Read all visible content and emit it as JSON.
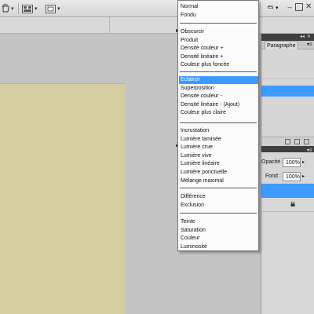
{
  "toolbar": {
    "items": [
      {
        "icon": "hand-tool-icon"
      },
      {
        "icon": "arrange-documents-icon"
      },
      {
        "icon": "screen-mode-icon"
      }
    ],
    "workspace_label": "es",
    "window_controls": {
      "minimize": "–",
      "maximize": "",
      "close": "✕"
    }
  },
  "panel_top": {
    "collapse_glyph": "◂◂",
    "close_glyph": "✕",
    "tab_label": "Paragraphe",
    "menu_glyph": "▾≡"
  },
  "layers_panel": {
    "opacity_label": "Opacité :",
    "opacity_value": "100%",
    "fill_label": "Fond :",
    "fill_value": "100%",
    "dropdown_caret": "▸",
    "menu_glyph": "▾≡"
  },
  "colors": {
    "selection": "#3d9bff",
    "canvas": "#d3cda0",
    "panel_header": "#3f3f3f"
  },
  "blend_menu": {
    "groups": [
      [
        "Normal",
        "Fondu"
      ],
      [
        "Obscurcir",
        "Produit",
        "Densité couleur +",
        "Densité linéaire +",
        "Couleur plus foncée"
      ],
      [
        "Eclaircir",
        "Superposition",
        "Densité couleur -",
        "Densité linéaire - (Ajout)",
        "Couleur plus claire"
      ],
      [
        "Incrustation",
        "Lumière tamisée",
        "Lumière crue",
        "Lumière vive",
        "Lumière linéaire",
        "Lumière ponctuelle",
        "Mélange maximal"
      ],
      [
        "Différence",
        "Exclusion"
      ],
      [
        "Teinte",
        "Saturation",
        "Couleur",
        "Luminosité"
      ]
    ],
    "selected": "Eclaircir"
  }
}
